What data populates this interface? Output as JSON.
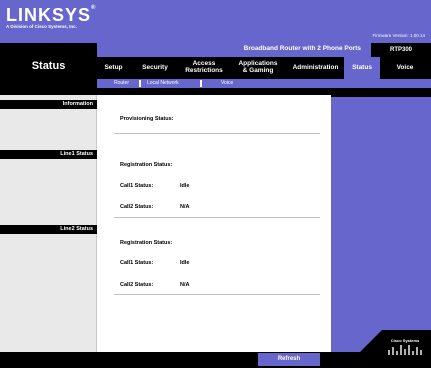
{
  "brand": {
    "logo": "LINKSYS",
    "logo_mark": "®",
    "subtitle": "A Division of Cisco Systems, Inc.",
    "firmware": "Firmware Version: 1.00.14"
  },
  "header": {
    "section_title": "Status",
    "product_name": "Broadband Router with 2 Phone Ports",
    "model": "RTP300"
  },
  "tabs": [
    {
      "label": "Setup",
      "active": false
    },
    {
      "label": "Security",
      "active": false
    },
    {
      "label": "Access\nRestrictions",
      "active": false
    },
    {
      "label": "Applications\n& Gaming",
      "active": false
    },
    {
      "label": "Administration",
      "active": false
    },
    {
      "label": "Status",
      "active": true
    },
    {
      "label": "Voice",
      "active": false
    }
  ],
  "subtabs": [
    "Router",
    "Local Network",
    "Voice"
  ],
  "sidebar": {
    "sections": [
      "Information",
      "Line1 Status",
      "Line2 Status"
    ]
  },
  "content": {
    "provisioning_label": "Provisioning Status:",
    "line1": {
      "registration_label": "Registration Status:",
      "call1_label": "Call1 Status:",
      "call1_value": "Idle",
      "call2_label": "Call2 Status:",
      "call2_value": "N/A"
    },
    "line2": {
      "registration_label": "Registration Status:",
      "call1_label": "Call1 Status:",
      "call1_value": "Idle",
      "call2_label": "Call2 Status:",
      "call2_value": "N/A"
    }
  },
  "footer": {
    "refresh_label": "Refresh",
    "cisco_text": "Cisco Systems"
  },
  "colors": {
    "accent": "#6666cc",
    "dark": "#000000",
    "sidebar": "#e9e9e9"
  }
}
